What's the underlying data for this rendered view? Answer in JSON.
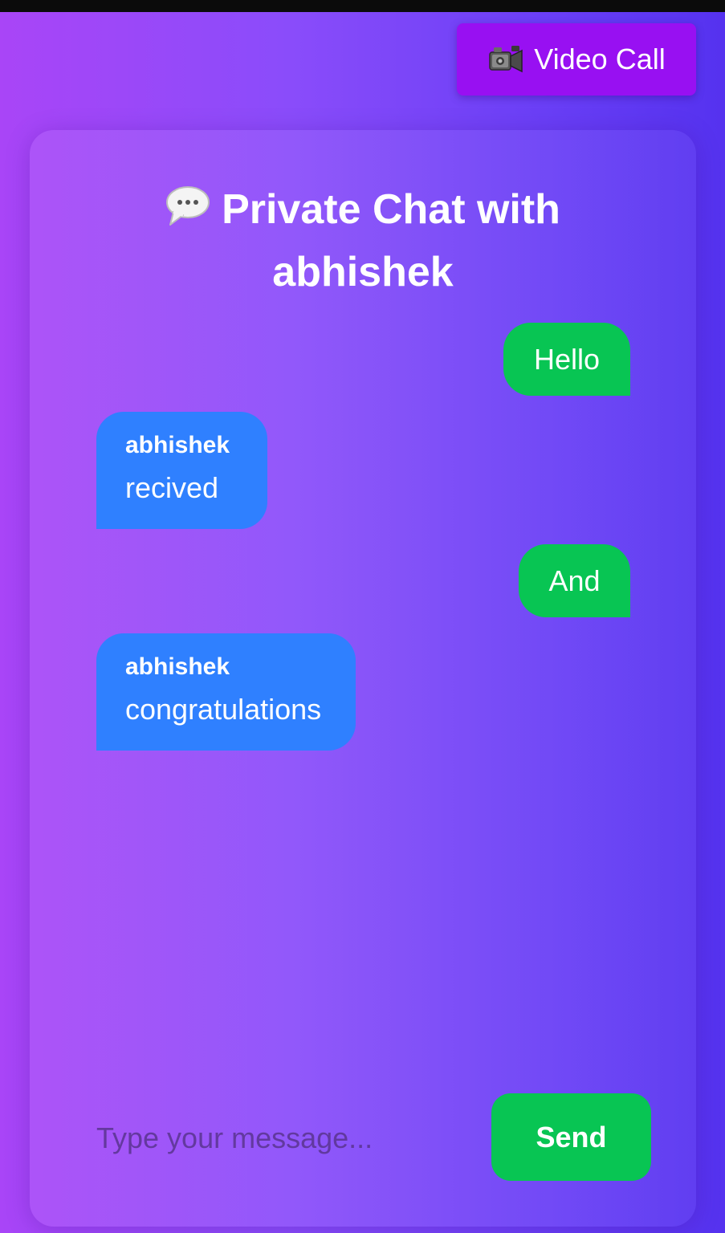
{
  "header": {
    "video_call_label": "Video Call",
    "video_call_icon": "video-camera-icon",
    "accent_color": "#9810f2"
  },
  "chat": {
    "title_line1": "Private Chat with",
    "title_line2": "abhishek",
    "title_icon": "speech-bubble-icon",
    "messages": [
      {
        "direction": "sent",
        "text": "Hello"
      },
      {
        "direction": "received",
        "sender": "abhishek",
        "text": "recived"
      },
      {
        "direction": "sent",
        "text": "And"
      },
      {
        "direction": "received",
        "sender": "abhishek",
        "text": "congratulations"
      }
    ],
    "sent_color": "#08c553",
    "received_color": "#2f80ff"
  },
  "composer": {
    "placeholder": "Type your message...",
    "value": "",
    "send_label": "Send"
  }
}
